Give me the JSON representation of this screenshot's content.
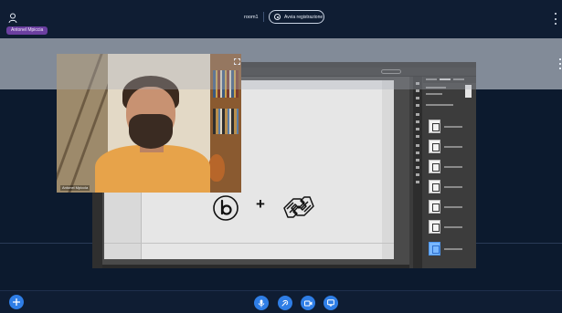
{
  "header": {
    "participant_chip": "Antonel Mpiccia",
    "room_title": "room1",
    "record_button_label": "Avvia registrazione"
  },
  "video_tile": {
    "participant_label": "Antonel Mpiccia"
  },
  "icons": {
    "user": "user-icon",
    "record": "record-icon",
    "more": "kebab-menu-icon",
    "expand": "expand-icon",
    "add": "plus-icon",
    "microphone": "microphone-icon",
    "screen_share": "screen-share-icon",
    "camera": "camera-icon",
    "chat": "chat-icon"
  },
  "colors": {
    "background": "#0c1a2e",
    "bar": "#0f1d33",
    "accent_blue": "#2f7ee6",
    "chip_purple": "#6b3fa0",
    "selected_layer": "#79b7ff"
  }
}
